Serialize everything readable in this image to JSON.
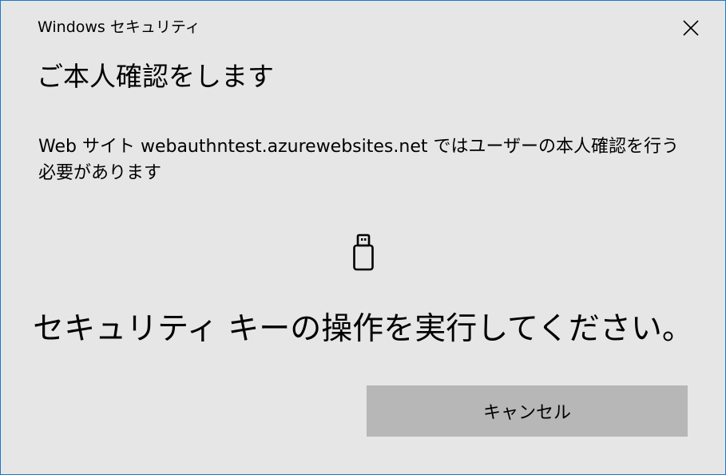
{
  "window": {
    "title": "Windows セキュリティ"
  },
  "dialog": {
    "heading": "ご本人確認をします",
    "message": "Web サイト webauthntest.azurewebsites.net ではユーザーの本人確認を行う必要があります",
    "instruction": "セキュリティ キーの操作を実行してください。",
    "cancel_label": "キャンセル"
  },
  "icons": {
    "close": "close-icon",
    "security_key": "usb-security-key-icon"
  },
  "colors": {
    "background": "#e6e6e6",
    "border": "#1979ca",
    "button": "#b7b7b7",
    "text": "#000000"
  }
}
